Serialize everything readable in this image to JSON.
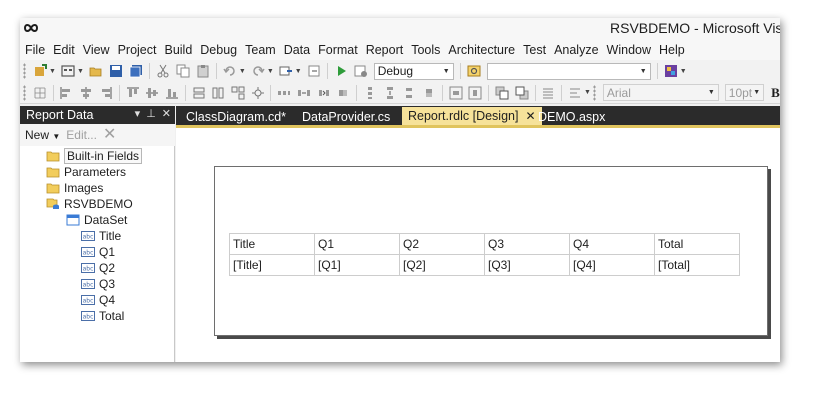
{
  "window": {
    "title": "RSVBDEMO - Microsoft Vis"
  },
  "menu": [
    "File",
    "Edit",
    "View",
    "Project",
    "Build",
    "Debug",
    "Team",
    "Data",
    "Format",
    "Report",
    "Tools",
    "Architecture",
    "Test",
    "Analyze",
    "Window",
    "Help"
  ],
  "toolbar": {
    "config_value": "Debug",
    "platform_value": "",
    "font_name": "Arial",
    "font_size": "10pt",
    "bold_label": "B"
  },
  "panel": {
    "title": "Report Data",
    "new_label": "New",
    "edit_label": "Edit...",
    "tree": {
      "builtin": "Built-in Fields",
      "parameters": "Parameters",
      "images": "Images",
      "datasource": "RSVBDEMO",
      "dataset": "DataSet",
      "fields": [
        "Title",
        "Q1",
        "Q2",
        "Q3",
        "Q4",
        "Total"
      ]
    }
  },
  "tabs": [
    {
      "label": "ClassDiagram.cd*"
    },
    {
      "label": "DataProvider.cs"
    },
    {
      "label": "Report.rdlc [Design]",
      "active": true
    },
    {
      "label": "DEMO.aspx"
    }
  ],
  "report": {
    "header": [
      "Title",
      "Q1",
      "Q2",
      "Q3",
      "Q4",
      "Total"
    ],
    "detail": [
      "[Title]",
      "[Q1]",
      "[Q2]",
      "[Q3]",
      "[Q4]",
      "[Total]"
    ]
  },
  "colors": {
    "active_tab": "#f6e29a",
    "tab_strip": "#2b2b2b",
    "panel_title": "#2b2b2b"
  }
}
